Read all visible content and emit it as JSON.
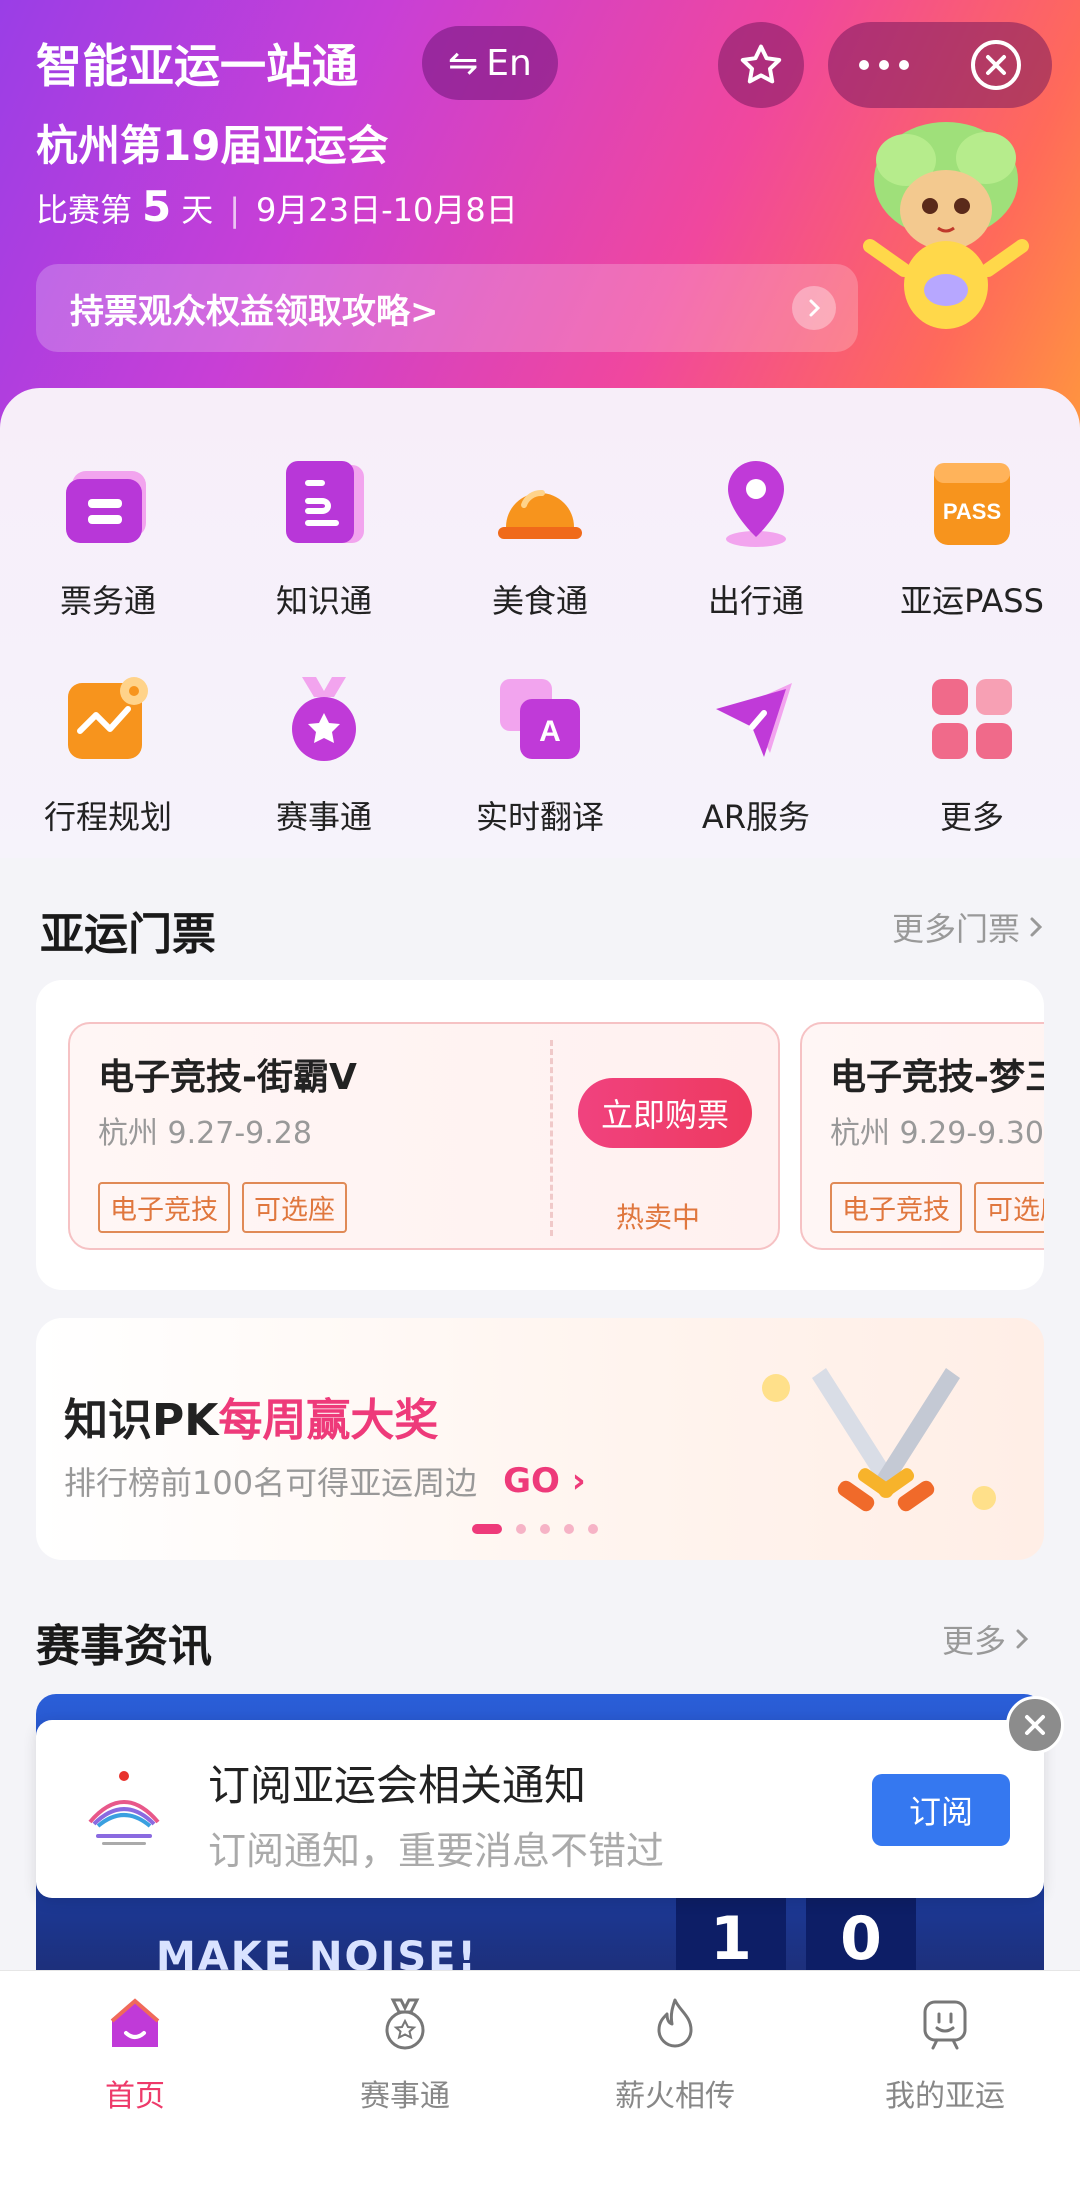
{
  "header": {
    "title": "智能亚运一站通",
    "lang_label": "En",
    "subtitle": "杭州第19届亚运会",
    "day_prefix": "比赛第",
    "day_number": "5",
    "day_suffix": "天",
    "date_range": "9月23日-10月8日",
    "banner_text": "持票观众权益领取攻略>"
  },
  "services": [
    {
      "label": "票务通",
      "icon": "ticket-icon"
    },
    {
      "label": "知识通",
      "icon": "book-icon"
    },
    {
      "label": "美食通",
      "icon": "food-bell-icon"
    },
    {
      "label": "出行通",
      "icon": "location-pin-icon"
    },
    {
      "label": "亚运PASS",
      "icon": "pass-icon",
      "icon_text": "PASS"
    },
    {
      "label": "行程规划",
      "icon": "itinerary-icon"
    },
    {
      "label": "赛事通",
      "icon": "medal-icon"
    },
    {
      "label": "实时翻译",
      "icon": "translate-icon",
      "icon_text": "A"
    },
    {
      "label": "AR服务",
      "icon": "ar-send-icon"
    },
    {
      "label": "更多",
      "icon": "more-grid-icon"
    }
  ],
  "tickets_section": {
    "title": "亚运门票",
    "more_label": "更多门票",
    "tickets": [
      {
        "name": "电子竞技-街霸V",
        "place": "杭州 9.27-9.28",
        "tags": [
          "电子竞技",
          "可选座"
        ],
        "buy_label": "立即购票",
        "status": "热卖中"
      },
      {
        "name": "电子竞技-梦三",
        "place": "杭州 9.29-9.30",
        "tags": [
          "电子竞技",
          "可选座"
        ]
      }
    ]
  },
  "pk_banner": {
    "title_plain": "知识PK",
    "title_highlight": "每周赢大奖",
    "subtitle": "排行榜前100名可得亚运周边",
    "go_label": "GO",
    "carousel_count": 5,
    "carousel_active": 1
  },
  "news_section": {
    "title": "赛事资讯",
    "more_label": "更多",
    "image_caption": "MAKE NOISE!",
    "score_left": "1",
    "score_right": "0"
  },
  "subscribe": {
    "title": "订阅亚运会相关通知",
    "description": "订阅通知，重要消息不错过",
    "button_label": "订阅"
  },
  "tabbar": [
    {
      "label": "首页",
      "icon": "home-icon",
      "active": true
    },
    {
      "label": "赛事通",
      "icon": "medal-outline-icon",
      "active": false
    },
    {
      "label": "薪火相传",
      "icon": "flame-icon",
      "active": false
    },
    {
      "label": "我的亚运",
      "icon": "profile-icon",
      "active": false
    }
  ],
  "colors": {
    "accent_pink": "#ee3a7a",
    "tag_orange": "#e0773e",
    "subscribe_blue": "#3578f0"
  }
}
